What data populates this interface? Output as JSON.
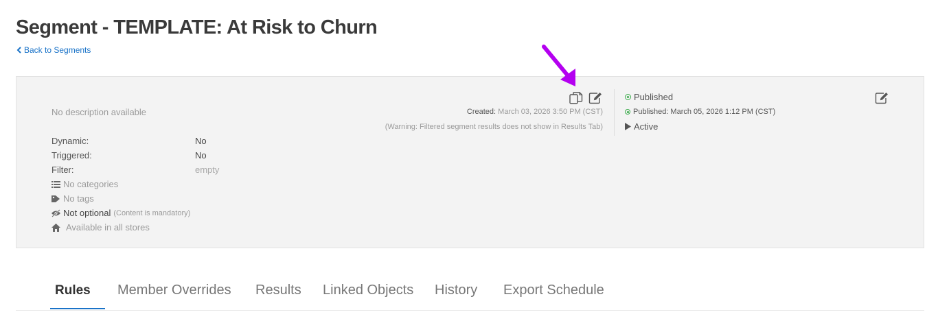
{
  "header": {
    "title": "Segment - TEMPLATE: At Risk to Churn",
    "back_link": "Back to Segments"
  },
  "details": {
    "description": "No description available",
    "fields": [
      {
        "label": "Dynamic:",
        "value": "No"
      },
      {
        "label": "Triggered:",
        "value": "No"
      },
      {
        "label": "Filter:",
        "value": "empty"
      }
    ],
    "categories": "No categories",
    "tags": "No tags",
    "optional": "Not optional",
    "optional_note": "(Content is mandatory)",
    "stores": "Available in all stores",
    "created_label": "Created:",
    "created_value": "March 03, 2026 3:50 PM (CST)",
    "warning": "(Warning: Filtered segment results does not show in Results Tab)"
  },
  "status": {
    "published": "Published",
    "published_on": "Published: March 05, 2026 1:12 PM (CST)",
    "active": "Active"
  },
  "tabs": [
    {
      "label": "Rules",
      "active": true
    },
    {
      "label": "Member Overrides"
    },
    {
      "label": "Results"
    },
    {
      "label": "Linked Objects"
    },
    {
      "label": "History"
    },
    {
      "label": "Export Schedule"
    }
  ],
  "colors": {
    "accent": "#1a73c8",
    "published_green": "#3aaa4a",
    "annotation_arrow": "#b400f0",
    "panel_bg": "#f3f3f3"
  },
  "icons": [
    "copy-icon",
    "edit-icon",
    "list-icon",
    "tag-icon",
    "eye-slash-icon",
    "home-icon",
    "play-icon",
    "chevron-left-icon",
    "check-circle-icon"
  ]
}
